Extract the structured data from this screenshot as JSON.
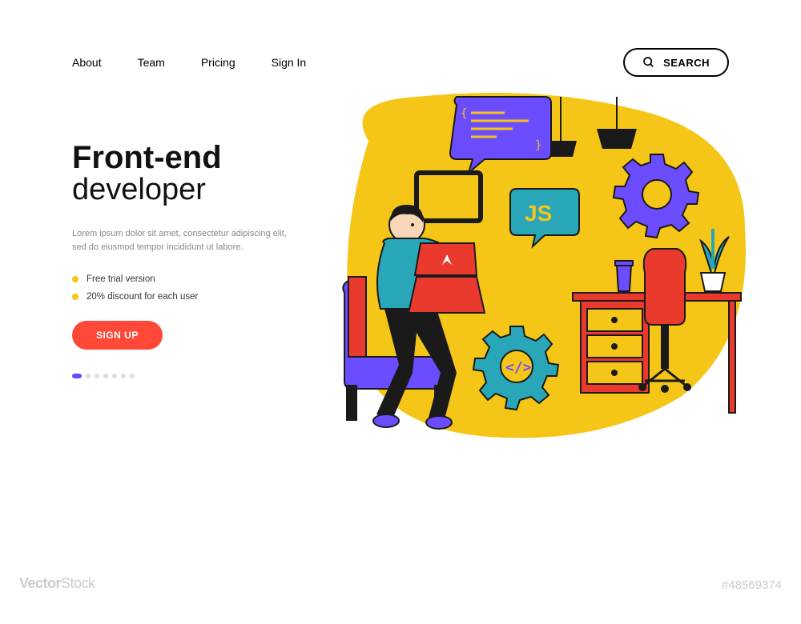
{
  "nav": {
    "links": [
      "About",
      "Team",
      "Pricing",
      "Sign In"
    ],
    "search_label": "SEARCH"
  },
  "hero": {
    "title_strong": "Front-end",
    "title_light": "developer",
    "desc": "Lorem ipsum dolor sit amet, consectetur adipiscing elit, sed do eiusmod tempor incididunt ut labore.",
    "bullets": [
      "Free trial version",
      "20% discount for each user"
    ],
    "cta_label": "SIGN UP"
  },
  "illustration": {
    "js_label": "JS"
  },
  "watermark": {
    "brand_a": "Vector",
    "brand_b": "Stock",
    "id": "#48569374"
  },
  "colors": {
    "yellow": "#f5c518",
    "red": "#ea3a2e",
    "purple": "#6c4cff",
    "teal": "#29a7b8",
    "dark": "#1a1a1a"
  }
}
